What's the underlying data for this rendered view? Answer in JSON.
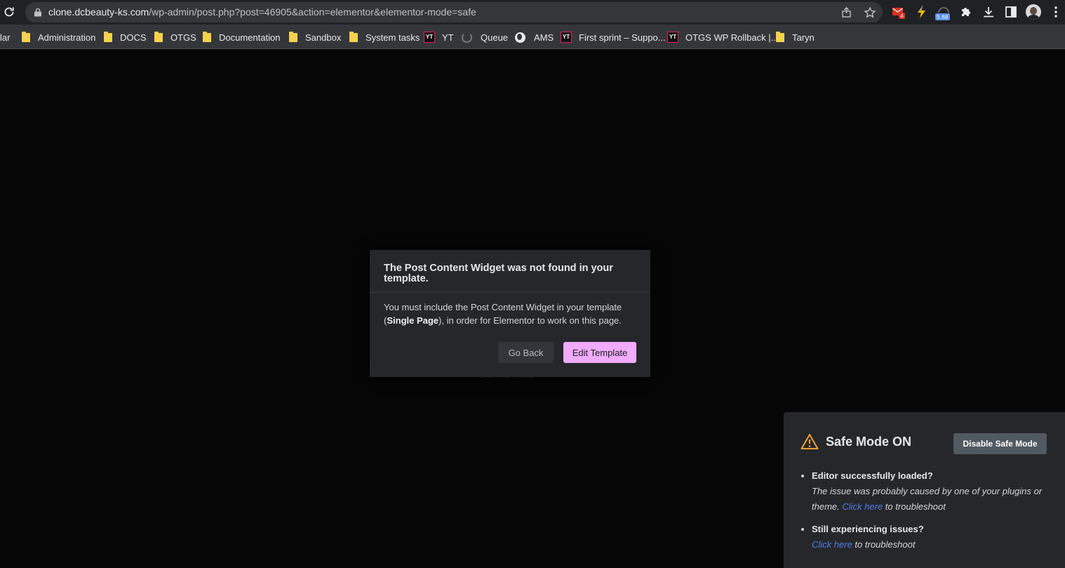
{
  "browser": {
    "url_host": "clone.dcbeauty-ks.com",
    "url_path": "/wp-admin/post.php?post=46905&action=elementor&elementor-mode=safe",
    "mail_badge": "4",
    "ext_badge": "5.68"
  },
  "bookmarks": [
    {
      "label": "lar",
      "icon": "none"
    },
    {
      "label": "Administration",
      "icon": "folder"
    },
    {
      "label": "DOCS",
      "icon": "folder"
    },
    {
      "label": "OTGS",
      "icon": "folder"
    },
    {
      "label": "Documentation",
      "icon": "folder"
    },
    {
      "label": "Sandbox",
      "icon": "folder"
    },
    {
      "label": "System tasks",
      "icon": "folder"
    },
    {
      "label": "YT",
      "icon": "yt"
    },
    {
      "label": "Queue",
      "icon": "queue"
    },
    {
      "label": "AMS",
      "icon": "globe"
    },
    {
      "label": "First sprint – Suppo...",
      "icon": "yt"
    },
    {
      "label": "OTGS WP Rollback |...",
      "icon": "yt"
    },
    {
      "label": "Taryn",
      "icon": "folder"
    }
  ],
  "loading_text": "LOADING",
  "dialog": {
    "title": "The Post Content Widget was not found in your template.",
    "body_start": "You must include the Post Content Widget in your template (",
    "body_bold": "Single Page",
    "body_end": "), in order for Elementor to work on this page.",
    "go_back": "Go Back",
    "edit_template": "Edit Template"
  },
  "safe_mode": {
    "title": "Safe Mode ON",
    "disable_button": "Disable Safe Mode",
    "item1_question": "Editor successfully loaded?",
    "item1_note": "The issue was probably caused by one of your plugins or theme.",
    "item1_link": "Click here",
    "item1_after": "to troubleshoot",
    "item2_question": "Still experiencing issues?",
    "item2_link": "Click here",
    "item2_after": "to troubleshoot"
  },
  "colors": {
    "accent_pink": "#f0abfc",
    "link_blue": "#4d7fe5",
    "warning_orange": "#f0a030"
  }
}
